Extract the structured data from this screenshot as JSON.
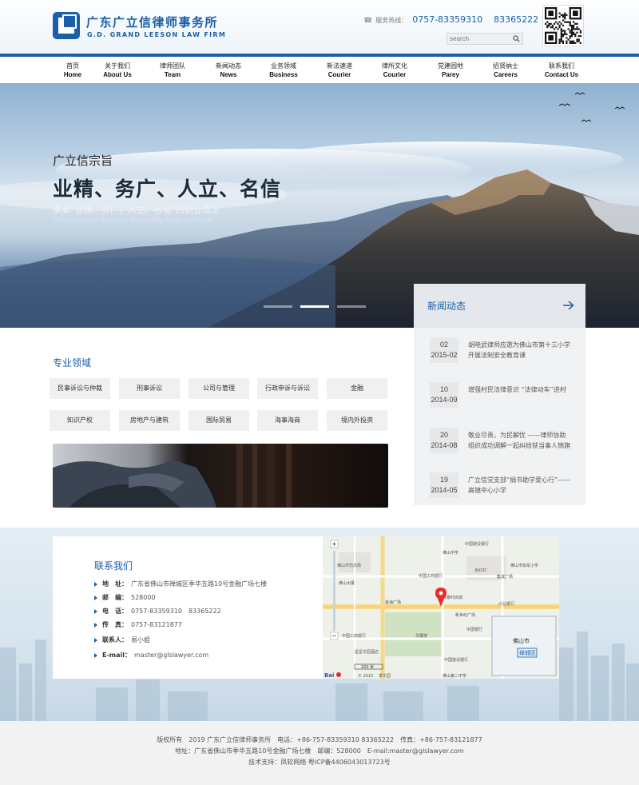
{
  "header": {
    "logo_cn": "广东广立信律师事务所",
    "logo_en": "G.D. GRAND LEESON LAW FIRM",
    "hotline_label": "服务热线：",
    "hotline_1": "0757-83359310",
    "hotline_2": "83365222",
    "search_placeholder": "search"
  },
  "nav": [
    {
      "cn": "首页",
      "en": "Home"
    },
    {
      "cn": "关于我们",
      "en": "About Us"
    },
    {
      "cn": "律师团队",
      "en": "Team"
    },
    {
      "cn": "新闻动态",
      "en": "News"
    },
    {
      "cn": "业务领域",
      "en": "Business"
    },
    {
      "cn": "新法速递",
      "en": "Courier"
    },
    {
      "cn": "律所文化",
      "en": "Courier"
    },
    {
      "cn": "党建园地",
      "en": "Parey"
    },
    {
      "cn": "招贤纳士",
      "en": "Careers"
    },
    {
      "cn": "联系我们",
      "en": "Contact Us"
    }
  ],
  "banner": {
    "sub": "广立信宗旨",
    "title": "业精、务广、人立、名信",
    "desc": "秉承“业精、务广、人立、名信”的创业理念",
    "eng": "Professionalism, Business, Personality, Fame and Credit"
  },
  "news": {
    "title": "新闻动态",
    "items": [
      {
        "day": "02",
        "ym": "2015-02",
        "text": "胡晓武律师应邀为佛山市第十三小学开展法制安全教育课"
      },
      {
        "day": "10",
        "ym": "2014-09",
        "text": "增强村民法律意识 “法律动车”进村"
      },
      {
        "day": "20",
        "ym": "2014-08",
        "text": "敬业尽责，为民解忧 ——律师协助组织成功调解一起纠纷获当事人锦旗致谢"
      },
      {
        "day": "19",
        "ym": "2014-05",
        "text": "广立信党支部“捐书助学爱心行”——高镇中心小学"
      }
    ]
  },
  "business": {
    "title": "专业领域",
    "items": [
      "民事诉讼与仲裁",
      "刑事诉讼",
      "公司与管理",
      "行政申诉与诉讼",
      "金融",
      "知识产权",
      "房地产与建筑",
      "国际贸易",
      "海事海商",
      "境内外投资"
    ]
  },
  "contact": {
    "title": "联系我们",
    "rows": [
      {
        "label": "地　址：",
        "value": "广东省佛山市禅城区季华五路10号金融广场七楼"
      },
      {
        "label": "邮　编：",
        "value": "528000"
      },
      {
        "label": "电　话：",
        "value": "0757-83359310　83365222"
      },
      {
        "label": "传　真：",
        "value": "0757-83121877"
      },
      {
        "label": "联系人：",
        "value": "易小姐"
      },
      {
        "label": "E-mail：",
        "value": "master@glslawyer.com"
      }
    ]
  },
  "map": {
    "labels": [
      "中国建设银行",
      "佛山中学",
      "佛山市司法局",
      "中国工商银行",
      "永红村",
      "集成广场",
      "佛山市铁军小学",
      "佛山大厦",
      "金海广场",
      "高泰时尚城",
      "兴业银行",
      "新世纪广场",
      "中国银行",
      "中国工商银行",
      "星星华园酒店",
      "华厦楼",
      "中国建设银行",
      "佛山第二中学",
      "佛山市",
      "禅城区",
      "季华园"
    ],
    "scale": "200 米",
    "copyright": "© 2015"
  },
  "footer": {
    "line1": "版权所有　2019 广东广立信律师事务所　电话：+86-757-83359310  83365222　传真：+86-757-83121877",
    "line2": "地址：广东省佛山市季华五路10号金融广场七楼　邮编：528000　E-mail:master@glslawyer.com",
    "line3": "技术支持：凤软网络 粤ICP备4406043013723号"
  },
  "colors": {
    "brand": "#1a5fa8",
    "nav_bar": "#1a5fa8",
    "footer_bg": "#f2f2f2"
  },
  "icons": [
    "logo-mark-icon",
    "phone-icon",
    "search-icon",
    "qr-code-icon",
    "arrow-right-icon",
    "triangle-bullet-icon",
    "map-marker-icon",
    "baidu-logo-icon"
  ]
}
